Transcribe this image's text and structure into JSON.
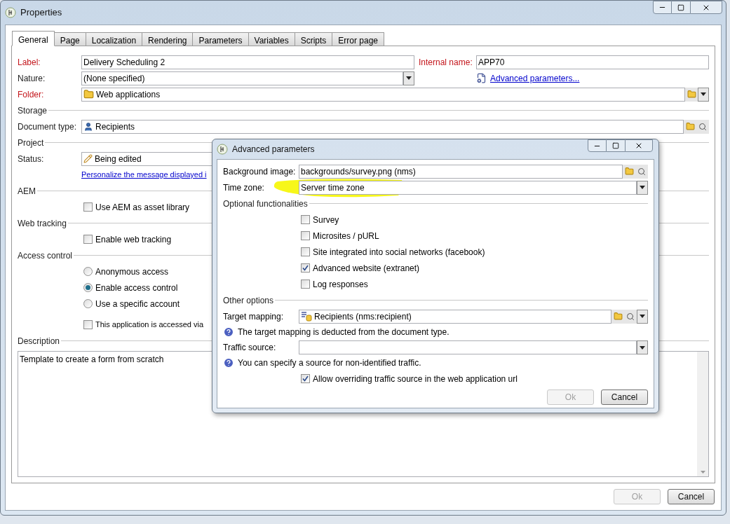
{
  "window": {
    "title": "Properties"
  },
  "tabs": [
    {
      "label": "General",
      "selected": true
    },
    {
      "label": "Page",
      "selected": false
    },
    {
      "label": "Localization",
      "selected": false
    },
    {
      "label": "Rendering",
      "selected": false
    },
    {
      "label": "Parameters",
      "selected": false
    },
    {
      "label": "Variables",
      "selected": false
    },
    {
      "label": "Scripts",
      "selected": false
    },
    {
      "label": "Error page",
      "selected": false
    }
  ],
  "label_field": {
    "label": "Label:",
    "value": "Delivery Scheduling 2",
    "required": true
  },
  "internal_name": {
    "label": "Internal name:",
    "value": "APP70",
    "required": true
  },
  "nature": {
    "label": "Nature:",
    "value": "(None specified)",
    "required": false
  },
  "advanced_link": "Advanced parameters...",
  "folder": {
    "label": "Folder:",
    "value": "Web applications",
    "required": true
  },
  "storage": {
    "heading": "Storage",
    "document_type": {
      "label": "Document type:",
      "value": "Recipients",
      "required": false
    }
  },
  "project": {
    "heading": "Project",
    "status": {
      "label": "Status:",
      "value": "Being edited",
      "required": false
    },
    "link": "Personalize the message displayed i"
  },
  "aem": {
    "heading": "AEM",
    "options": [
      {
        "label": "Use AEM as asset library",
        "checked": false
      }
    ]
  },
  "web_tracking": {
    "heading": "Web tracking",
    "options": [
      {
        "label": "Enable web tracking",
        "checked": false
      }
    ]
  },
  "access_control": {
    "heading": "Access control",
    "radios": [
      {
        "label": "Anonymous access",
        "selected": false
      },
      {
        "label": "Enable access control",
        "selected": true
      },
      {
        "label": "Use a specific account",
        "selected": false
      }
    ],
    "options": [
      {
        "label": "This application is accessed via",
        "checked": false
      }
    ]
  },
  "description": {
    "heading": "Description",
    "value": "Template to create a form from scratch"
  },
  "buttons": [
    {
      "label": "Ok",
      "disabled": true
    },
    {
      "label": "Cancel",
      "disabled": false
    }
  ],
  "dialog": {
    "title": "Advanced parameters",
    "background_image": {
      "label": "Background image:",
      "value": "backgrounds/survey.png (nms)"
    },
    "time_zone": {
      "label": "Time zone:",
      "value": "Server time zone",
      "highlighted": true
    },
    "optional": {
      "heading": "Optional functionalities",
      "options": [
        {
          "label": "Survey",
          "checked": false
        },
        {
          "label": "Microsites / pURL",
          "checked": false
        },
        {
          "label": "Site integrated into social networks (facebook)",
          "checked": false
        },
        {
          "label": "Advanced website (extranet)",
          "checked": true
        },
        {
          "label": "Log responses",
          "checked": false
        }
      ]
    },
    "other": {
      "heading": "Other options",
      "target_mapping": {
        "label": "Target mapping:",
        "value": "Recipients (nms:recipient)"
      },
      "target_hint": "The target mapping is deducted from the document type.",
      "traffic_source": {
        "label": "Traffic source:"
      },
      "traffic_hint": "You can specify a source for non-identified traffic.",
      "options": [
        {
          "label": "Allow overriding traffic source in the web application url",
          "checked": true
        }
      ]
    },
    "buttons": [
      {
        "label": "Ok",
        "disabled": true
      },
      {
        "label": "Cancel",
        "disabled": false
      }
    ]
  }
}
